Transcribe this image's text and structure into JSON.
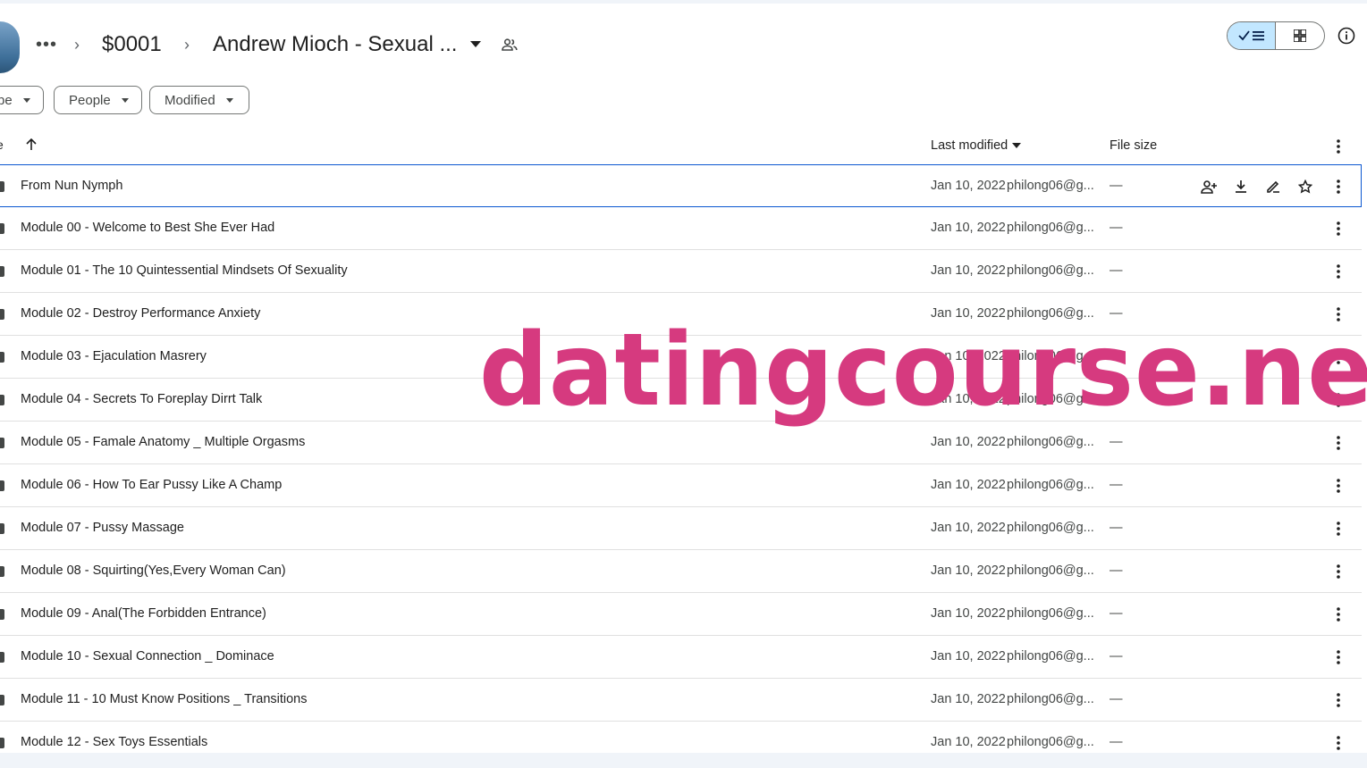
{
  "breadcrumb": {
    "more": "•••",
    "folder": "$0001",
    "current": "Andrew Mioch - Sexual ...",
    "sep": "›"
  },
  "filters": {
    "type": "pe",
    "people": "People",
    "modified": "Modified"
  },
  "columns": {
    "name": "e",
    "last_modified": "Last modified",
    "file_size": "File size"
  },
  "rows": [
    {
      "name": "From Nun Nymph",
      "date": "Jan 10, 2022",
      "owner": "philong06@g...",
      "size": "—"
    },
    {
      "name": "Module 00 - Welcome to Best She Ever Had",
      "date": "Jan 10, 2022",
      "owner": "philong06@g...",
      "size": "—"
    },
    {
      "name": "Module 01 - The 10 Quintessential Mindsets Of Sexuality",
      "date": "Jan 10, 2022",
      "owner": "philong06@g...",
      "size": "—"
    },
    {
      "name": "Module 02 - Destroy Performance Anxiety",
      "date": "Jan 10, 2022",
      "owner": "philong06@g...",
      "size": "—"
    },
    {
      "name": "Module 03 - Ejaculation Masrery",
      "date": "Jan 10, 2022",
      "owner": "philong06@g...",
      "size": "—"
    },
    {
      "name": "Module 04 - Secrets To Foreplay Dirrt Talk",
      "date": "Jan 10, 2022",
      "owner": "philong06@g...",
      "size": "—"
    },
    {
      "name": "Module 05 - Famale Anatomy _ Multiple Orgasms",
      "date": "Jan 10, 2022",
      "owner": "philong06@g...",
      "size": "—"
    },
    {
      "name": "Module 06 - How To Ear Pussy Like A Champ",
      "date": "Jan 10, 2022",
      "owner": "philong06@g...",
      "size": "—"
    },
    {
      "name": "Module 07 - Pussy Massage",
      "date": "Jan 10, 2022",
      "owner": "philong06@g...",
      "size": "—"
    },
    {
      "name": "Module 08 - Squirting(Yes,Every Woman Can)",
      "date": "Jan 10, 2022",
      "owner": "philong06@g...",
      "size": "—"
    },
    {
      "name": "Module 09 - Anal(The Forbidden Entrance)",
      "date": "Jan 10, 2022",
      "owner": "philong06@g...",
      "size": "—"
    },
    {
      "name": "Module 10 - Sexual Connection _ Dominace",
      "date": "Jan 10, 2022",
      "owner": "philong06@g...",
      "size": "—"
    },
    {
      "name": "Module 11 - 10 Must Know Positions _ Transitions",
      "date": "Jan 10, 2022",
      "owner": "philong06@g...",
      "size": "—"
    },
    {
      "name": "Module 12 - Sex Toys Essentials",
      "date": "Jan 10, 2022",
      "owner": "philong06@g...",
      "size": "—"
    }
  ],
  "watermark": "datingcourse.net",
  "colors": {
    "accent": "#0b57d0",
    "toggle_active": "#c2e7ff",
    "watermark": "#d63a7f"
  },
  "icons": {
    "row_actions": [
      "share-icon",
      "download-icon",
      "rename-icon",
      "star-icon"
    ]
  }
}
